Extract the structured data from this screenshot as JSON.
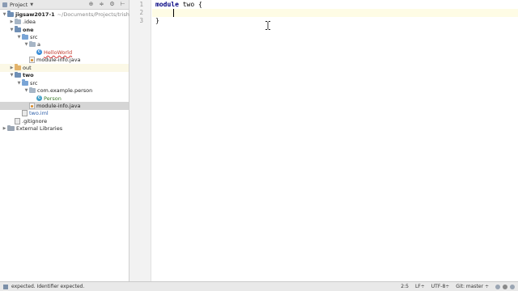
{
  "project_panel": {
    "title": "Project",
    "tree": [
      {
        "indent": 0,
        "arrow": "▼",
        "icon": "module",
        "label": "jigsaw2017-1",
        "path": "~/Documents/Projects/trishag",
        "bold": true
      },
      {
        "indent": 1,
        "arrow": "▶",
        "icon": "plain",
        "label": ".idea"
      },
      {
        "indent": 1,
        "arrow": "▼",
        "icon": "module",
        "label": "one",
        "bold": true
      },
      {
        "indent": 2,
        "arrow": "▼",
        "icon": "src",
        "label": "src"
      },
      {
        "indent": 3,
        "arrow": "▼",
        "icon": "plain",
        "label": "a"
      },
      {
        "indent": 4,
        "arrow": "",
        "icon": "class",
        "label": "HelloWorld",
        "error": true
      },
      {
        "indent": 3,
        "arrow": "",
        "icon": "java",
        "label": "module-info.java"
      },
      {
        "indent": 1,
        "arrow": "▶",
        "icon": "excluded",
        "label": "out",
        "highlight": true
      },
      {
        "indent": 1,
        "arrow": "▼",
        "icon": "module",
        "label": "two",
        "bold": true
      },
      {
        "indent": 2,
        "arrow": "▼",
        "icon": "src",
        "label": "src"
      },
      {
        "indent": 3,
        "arrow": "▼",
        "icon": "plain",
        "label": "com.example.person"
      },
      {
        "indent": 4,
        "arrow": "",
        "icon": "class",
        "label": "Person",
        "added": true
      },
      {
        "indent": 3,
        "arrow": "",
        "icon": "java",
        "label": "module-info.java",
        "selected": true
      },
      {
        "indent": 2,
        "arrow": "",
        "icon": "iml",
        "label": "two.iml",
        "blue": true
      },
      {
        "indent": 1,
        "arrow": "",
        "icon": "git",
        "label": ".gitignore"
      },
      {
        "indent": 0,
        "arrow": "▶",
        "icon": "library",
        "label": "External Libraries"
      }
    ]
  },
  "editor": {
    "line_numbers": [
      "1",
      "2",
      "3"
    ],
    "lines": [
      {
        "keyword": "module",
        "rest": " two {"
      },
      {
        "keyword": "",
        "rest": "    "
      },
      {
        "keyword": "",
        "rest": "}"
      }
    ]
  },
  "status_bar": {
    "message": "expected. Identifier expected.",
    "position": "2:5",
    "line_separator": "LF÷",
    "encoding": "UTF-8÷",
    "vcs": "Git: master ÷"
  }
}
